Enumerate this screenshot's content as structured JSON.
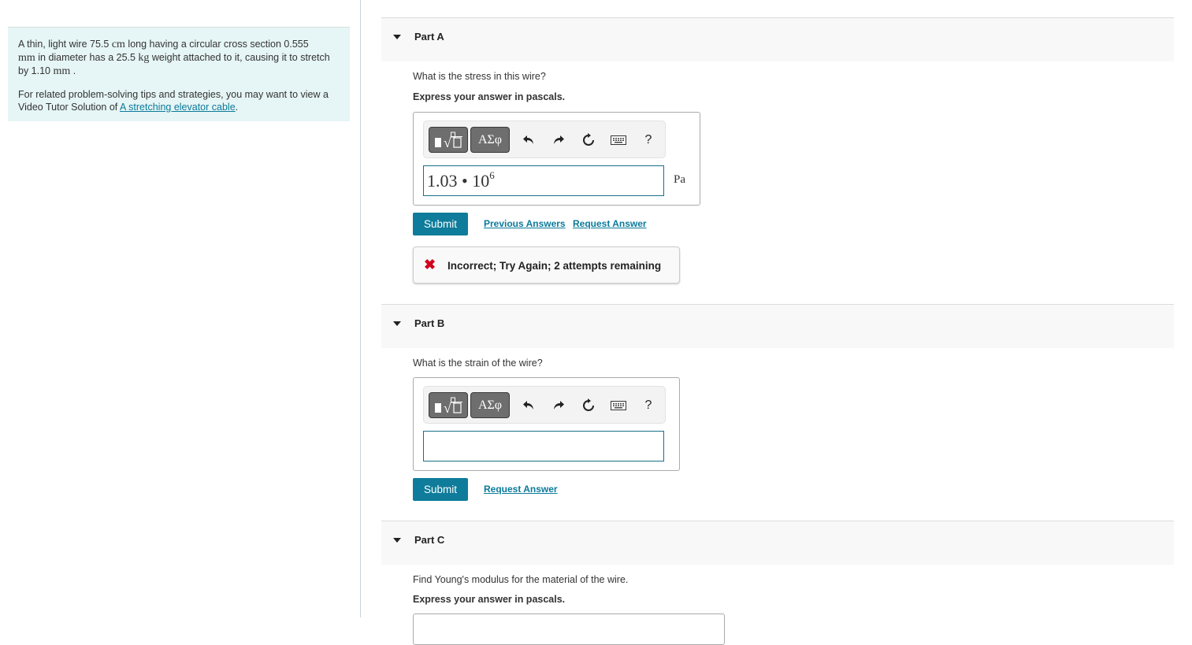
{
  "problem": {
    "sentence_parts": [
      "A thin, light wire 75.5 ",
      "cm",
      " long having a circular cross section 0.555 ",
      "mm",
      " in diameter has a 25.5 ",
      "kg",
      " weight attached to it, causing it to stretch by 1.10 ",
      "mm",
      " ."
    ],
    "tip_text": "For related problem-solving tips and strategies, you may want to view a Video Tutor Solution of ",
    "tip_link": "A stretching elevator cable",
    "tip_end": "."
  },
  "toolbar": {
    "templates_label": "templates",
    "symbols_label": "ΑΣφ",
    "undo": "↶",
    "redo": "↷",
    "reset": "⟳",
    "help": "?"
  },
  "parts": [
    {
      "title": "Part A",
      "question": "What is the stress in this wire?",
      "instruction": "Express your answer in pascals.",
      "answer_mantissa": "1.03 • 10",
      "answer_exponent": "6",
      "unit": "Pa",
      "submit_label": "Submit",
      "previous_answers_label": "Previous Answers",
      "request_answer_label": "Request Answer",
      "feedback": "Incorrect; Try Again; 2 attempts remaining"
    },
    {
      "title": "Part B",
      "question": "What is the strain of the wire?",
      "answer_value": "",
      "submit_label": "Submit",
      "request_answer_label": "Request Answer"
    },
    {
      "title": "Part C",
      "question": "Find Young's modulus for the material of the wire.",
      "instruction": "Express your answer in pascals."
    }
  ],
  "colors": {
    "accent": "#0e7c9a",
    "panel_bg": "#e6f5f5",
    "error": "#d0021b"
  }
}
